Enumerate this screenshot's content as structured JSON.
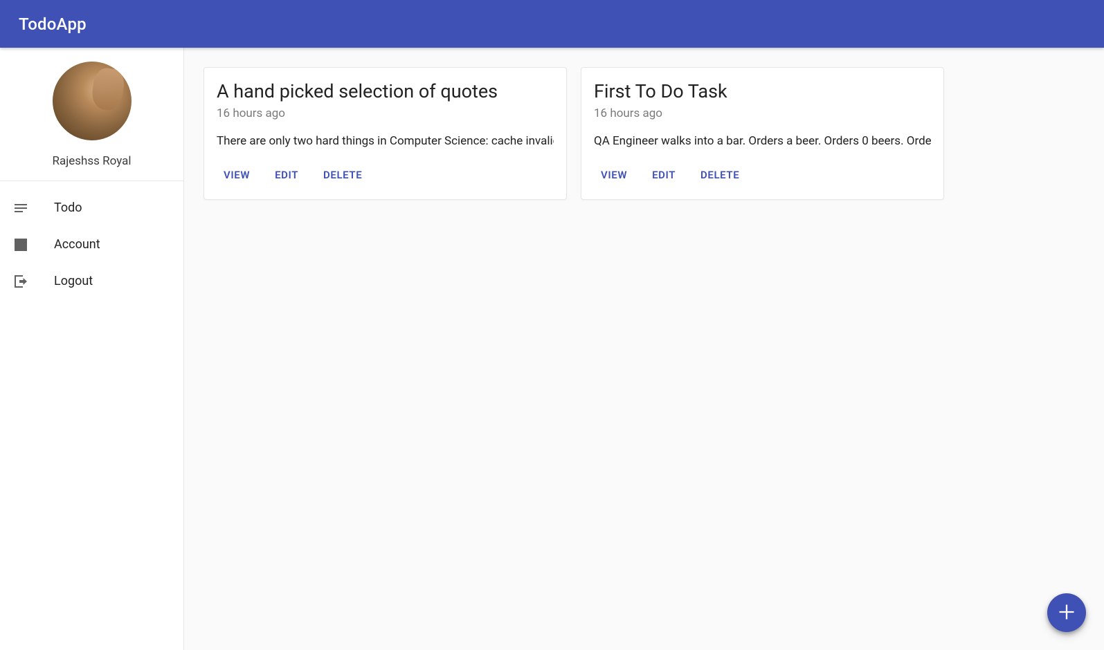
{
  "header": {
    "title": "TodoApp"
  },
  "user": {
    "name": "Rajeshss Royal"
  },
  "sidebar": {
    "items": [
      {
        "label": "Todo",
        "icon": "notes-icon"
      },
      {
        "label": "Account",
        "icon": "account-icon"
      },
      {
        "label": "Logout",
        "icon": "logout-icon"
      }
    ]
  },
  "cards": [
    {
      "title": "A hand picked selection of quotes",
      "time": "16 hours ago",
      "body": "There are only two hard things in Computer Science: cache invalid",
      "actions": {
        "view": "VIEW",
        "edit": "EDIT",
        "delete": "DELETE"
      }
    },
    {
      "title": "First To Do Task",
      "time": "16 hours ago",
      "body": "QA Engineer walks into a bar. Orders a beer. Orders 0 beers. Orde",
      "actions": {
        "view": "VIEW",
        "edit": "EDIT",
        "delete": "DELETE"
      }
    }
  ],
  "fab": {
    "label": "Add"
  }
}
